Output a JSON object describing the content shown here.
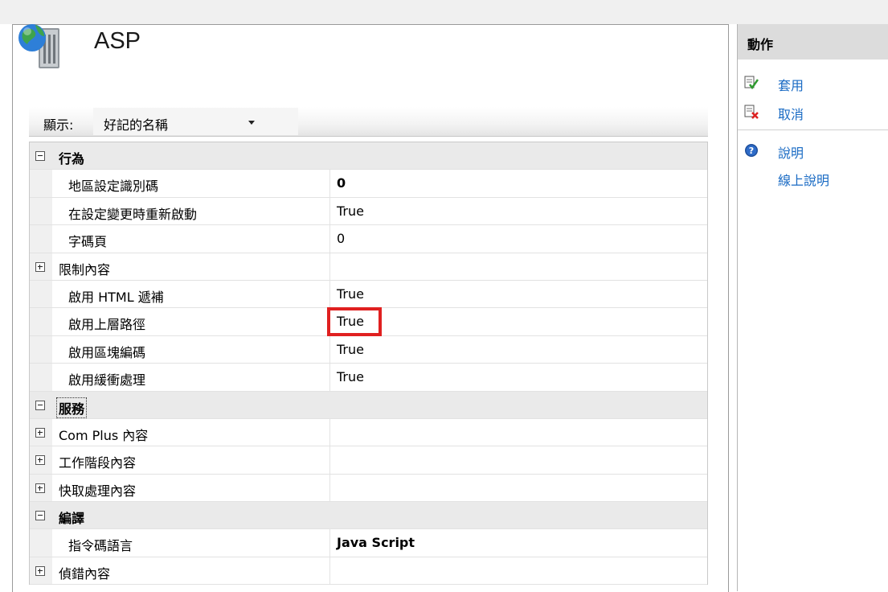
{
  "page": {
    "title": "ASP"
  },
  "display": {
    "label": "顯示:",
    "value": "好記的名稱"
  },
  "grid": {
    "rows": [
      {
        "type": "category",
        "toggle": "minus",
        "name": "行為",
        "value": ""
      },
      {
        "type": "prop",
        "name": "地區設定識別碼",
        "value": "0",
        "bold": true
      },
      {
        "type": "prop",
        "name": "在設定變更時重新啟動",
        "value": "True"
      },
      {
        "type": "prop",
        "name": "字碼頁",
        "value": "0"
      },
      {
        "type": "prop-expand",
        "toggle": "plus",
        "name": "限制內容",
        "value": ""
      },
      {
        "type": "prop",
        "name": "啟用 HTML 遞補",
        "value": "True"
      },
      {
        "type": "prop",
        "name": "啟用上層路徑",
        "value": "True",
        "highlighted": true
      },
      {
        "type": "prop",
        "name": "啟用區塊編碼",
        "value": "True"
      },
      {
        "type": "prop",
        "name": "啟用緩衝處理",
        "value": "True"
      },
      {
        "type": "category",
        "toggle": "minus",
        "name": "服務",
        "value": "",
        "focused": true
      },
      {
        "type": "prop-expand",
        "toggle": "plus",
        "name": "Com Plus 內容",
        "value": ""
      },
      {
        "type": "prop-expand",
        "toggle": "plus",
        "name": "工作階段內容",
        "value": ""
      },
      {
        "type": "prop-expand",
        "toggle": "plus",
        "name": "快取處理內容",
        "value": ""
      },
      {
        "type": "category",
        "toggle": "minus",
        "name": "編譯",
        "value": ""
      },
      {
        "type": "prop",
        "name": "指令碼語言",
        "value": "Java Script",
        "bold": true
      },
      {
        "type": "prop-expand",
        "toggle": "plus",
        "name": "偵錯內容",
        "value": ""
      }
    ]
  },
  "actions": {
    "title": "動作",
    "items": [
      {
        "label": "套用",
        "icon": "apply-icon"
      },
      {
        "label": "取消",
        "icon": "cancel-icon"
      },
      {
        "label": "說明",
        "icon": "help-icon"
      },
      {
        "label": "線上說明",
        "icon": ""
      }
    ]
  },
  "colors": {
    "highlight_border": "#e02020",
    "link": "#1a6bc4",
    "actions_header_bg": "#dcdcdc"
  }
}
